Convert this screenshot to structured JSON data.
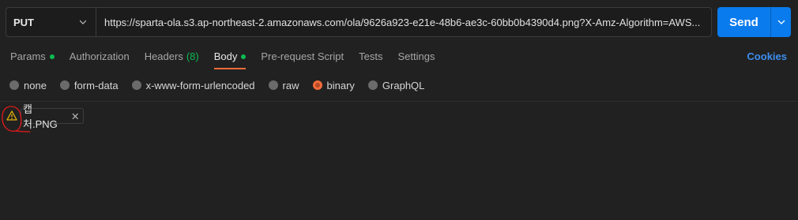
{
  "request": {
    "method": "PUT",
    "url": "https://sparta-ola.s3.ap-northeast-2.amazonaws.com/ola/9626a923-e21e-48b6-ae3c-60bb0b4390d4.png?X-Amz-Algorithm=AWS...",
    "send_label": "Send"
  },
  "tabs": [
    {
      "label": "Params",
      "dot": true
    },
    {
      "label": "Authorization"
    },
    {
      "label": "Headers",
      "count": "(8)"
    },
    {
      "label": "Body",
      "dot": true,
      "active": true
    },
    {
      "label": "Pre-request Script"
    },
    {
      "label": "Tests"
    },
    {
      "label": "Settings"
    }
  ],
  "cookies_label": "Cookies",
  "body_types": [
    {
      "label": "none"
    },
    {
      "label": "form-data"
    },
    {
      "label": "x-www-form-urlencoded"
    },
    {
      "label": "raw"
    },
    {
      "label": "binary",
      "selected": true
    },
    {
      "label": "GraphQL"
    }
  ],
  "file": {
    "name": "캡처.PNG",
    "warning_icon": "warning-icon"
  },
  "colors": {
    "accent": "#f26b3a",
    "send": "#097bed",
    "status_green": "#0cbb52",
    "link": "#3d8ef0",
    "warning": "#e8b30a",
    "annotation": "#e01a1a"
  }
}
